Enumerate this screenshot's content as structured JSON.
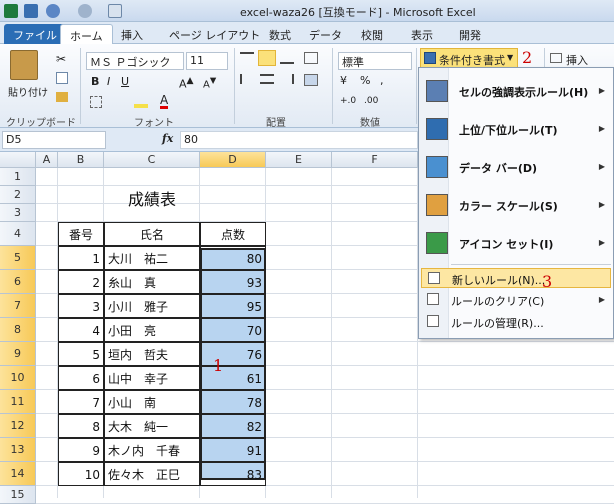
{
  "window": {
    "title": "excel-waza26  [互換モード] - Microsoft Excel"
  },
  "tabs": [
    "ファイル",
    "ホーム",
    "挿入",
    "ページ レイアウト",
    "数式",
    "データ",
    "校閲",
    "表示",
    "開発"
  ],
  "ribbon": {
    "paste_label": "貼り付け",
    "clipboard_group": "クリップボード",
    "font_name": "ＭＳ Ｐゴシック",
    "font_size": "11",
    "font_group": "フォント",
    "align_group": "配置",
    "number_format": "標準",
    "number_group": "数値",
    "cond_format_button": "条件付き書式",
    "insert_button": "挿入"
  },
  "formula_bar": {
    "name_box": "D5",
    "fx": "fx",
    "value": "80"
  },
  "columns": [
    "A",
    "B",
    "C",
    "D",
    "E",
    "F"
  ],
  "rows": [
    "1",
    "2",
    "3",
    "4",
    "5",
    "6",
    "7",
    "8",
    "9",
    "10",
    "11",
    "12",
    "13",
    "14",
    "15"
  ],
  "sheet": {
    "title": "成績表",
    "headers": [
      "番号",
      "氏名",
      "点数"
    ],
    "records": [
      {
        "no": "1",
        "name": "大川　祐二",
        "score": "80"
      },
      {
        "no": "2",
        "name": "糸山　真",
        "score": "93"
      },
      {
        "no": "3",
        "name": "小川　雅子",
        "score": "95"
      },
      {
        "no": "4",
        "name": "小田　亮",
        "score": "70"
      },
      {
        "no": "5",
        "name": "垣内　哲夫",
        "score": "76"
      },
      {
        "no": "6",
        "name": "山中　幸子",
        "score": "61"
      },
      {
        "no": "7",
        "name": "小山　南",
        "score": "78"
      },
      {
        "no": "8",
        "name": "大木　純一",
        "score": "82"
      },
      {
        "no": "9",
        "name": "木ノ内　千春",
        "score": "91"
      },
      {
        "no": "10",
        "name": "佐々木　正巳",
        "score": "83"
      }
    ]
  },
  "menu": {
    "items": [
      {
        "label": "セルの強調表示ルール(H)",
        "icon": "highlight-rules-icon"
      },
      {
        "label": "上位/下位ルール(T)",
        "icon": "top-bottom-icon"
      },
      {
        "label": "データ バー(D)",
        "icon": "data-bar-icon"
      },
      {
        "label": "カラー スケール(S)",
        "icon": "color-scale-icon"
      },
      {
        "label": "アイコン セット(I)",
        "icon": "icon-set-icon"
      }
    ],
    "small_items": [
      {
        "label": "新しいルール(N)..."
      },
      {
        "label": "ルールのクリア(C)"
      },
      {
        "label": "ルールの管理(R)..."
      }
    ]
  },
  "annotations": {
    "one": "1",
    "two": "2",
    "three": "3"
  },
  "colors": {
    "selection": "#b8d4f0",
    "highlight": "#fde7a3",
    "annotation": "#cc0000"
  }
}
